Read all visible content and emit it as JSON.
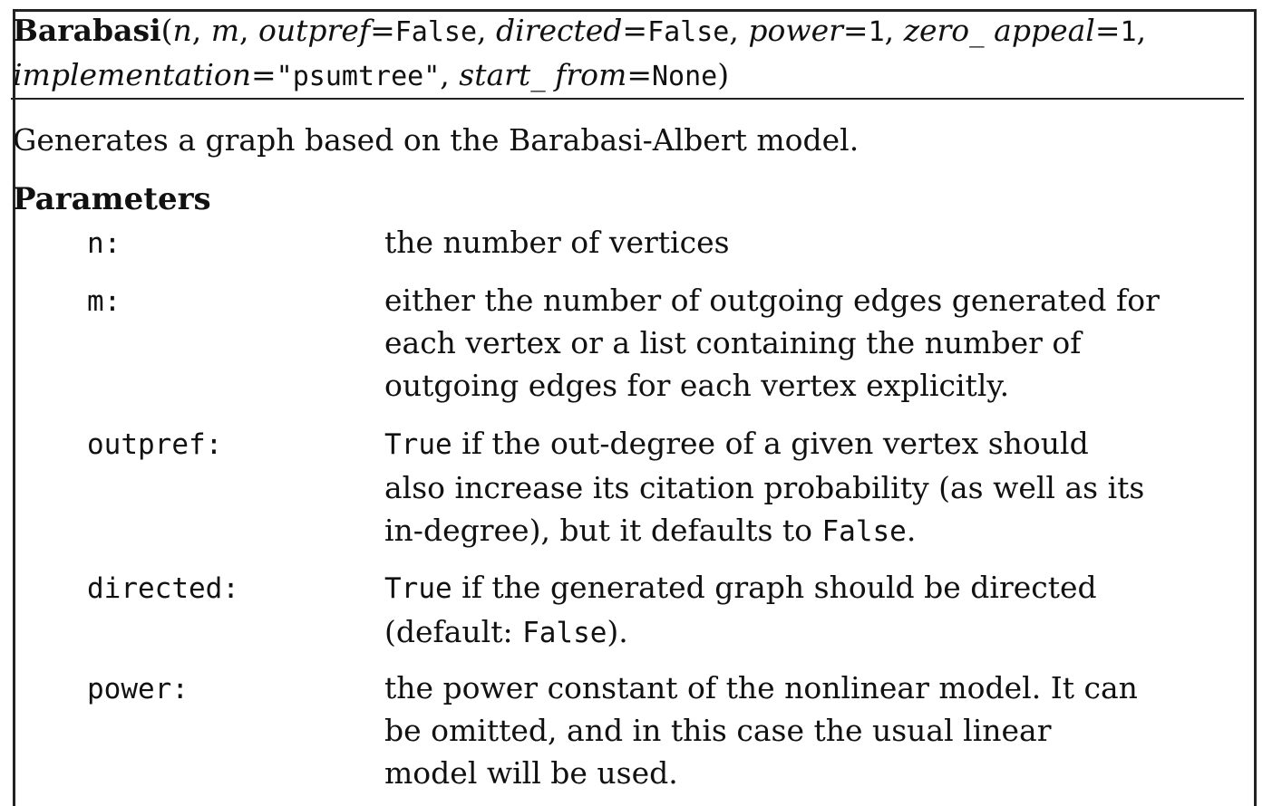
{
  "signature": {
    "name": "Barabasi",
    "open_paren": "(",
    "close_paren": ")",
    "sep": ", ",
    "eq": "=",
    "args": [
      {
        "name": "n"
      },
      {
        "name": "m"
      },
      {
        "name": "outpref",
        "default": "False"
      },
      {
        "name": "directed",
        "default": "False"
      },
      {
        "name": "power",
        "default": "1"
      },
      {
        "name": "zero_ appeal",
        "default": "1"
      },
      {
        "name": "implementation",
        "default": "\"psumtree\""
      },
      {
        "name": "start_ from",
        "default": "None"
      }
    ]
  },
  "description": "Generates a graph based on the Barabasi-Albert model.",
  "parameters_heading": "Parameters",
  "params": [
    {
      "name": "n:",
      "lines": [
        [
          "the number of vertices"
        ]
      ]
    },
    {
      "name": "m:",
      "lines": [
        [
          "either the number of outgoing edges generated for"
        ],
        [
          "each vertex or a list containing the number of"
        ],
        [
          "outgoing edges for each vertex explicitly."
        ]
      ]
    },
    {
      "name": "outpref:",
      "lines": [
        [
          "True",
          " if the out-degree of a given vertex should"
        ],
        [
          "also increase its citation probability (as well as its"
        ],
        [
          "in-degree), but it defaults to ",
          "False",
          "."
        ]
      ]
    },
    {
      "name": "directed:",
      "lines": [
        [
          "True",
          " if the generated graph should be directed"
        ],
        [
          "(default: ",
          "False",
          ")."
        ]
      ]
    },
    {
      "name": "power:",
      "lines": [
        [
          "the power constant of the nonlinear model.  It can"
        ],
        [
          "be omitted, and in this case the usual linear"
        ],
        [
          "model will be used."
        ]
      ]
    }
  ]
}
